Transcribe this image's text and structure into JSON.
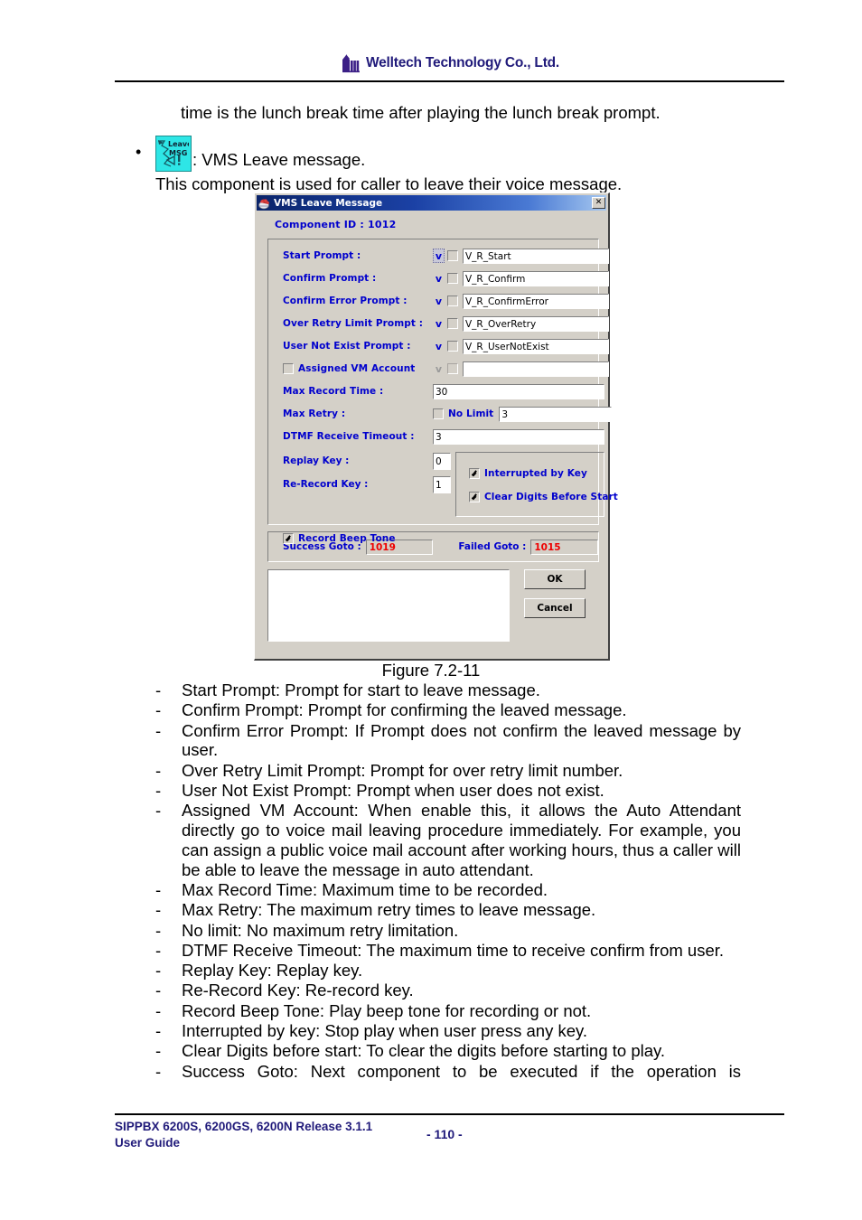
{
  "header": {
    "company": "Welltech Technology Co., Ltd.",
    "logo_icon": "welltech-logo-icon"
  },
  "intro_line": "time is the lunch break time after playing the lunch break prompt.",
  "bullet": {
    "marker": "•",
    "icon_name": "leave-msg-icon",
    "icon_text_top": "Leave",
    "icon_text_bottom": "MSG",
    "caption": ": VMS Leave message.",
    "description": "This component is used for caller to leave their voice message."
  },
  "dialog": {
    "title": "VMS Leave Message",
    "title_icon": "vms-app-icon",
    "close_label": "✕",
    "component_id": "Component ID : 1012",
    "prompt_rows": [
      {
        "label": "Start Prompt :",
        "dropdown": "v",
        "dropdown_focused": true,
        "checked": false,
        "value": "V_R_Start"
      },
      {
        "label": "Confirm Prompt :",
        "dropdown": "v",
        "dropdown_focused": false,
        "checked": false,
        "value": "V_R_Confirm"
      },
      {
        "label": "Confirm Error Prompt :",
        "dropdown": "v",
        "dropdown_focused": false,
        "checked": false,
        "value": "V_R_ConfirmError"
      },
      {
        "label": "Over Retry Limit Prompt :",
        "dropdown": "v",
        "dropdown_focused": false,
        "checked": false,
        "value": "V_R_OverRetry"
      },
      {
        "label": "User Not Exist Prompt :",
        "dropdown": "v",
        "dropdown_focused": false,
        "checked": false,
        "value": "V_R_UserNotExist"
      }
    ],
    "assigned_vm": {
      "label": "Assigned VM Account",
      "checked": false,
      "dropdown": "v",
      "value": ""
    },
    "max_record_time": {
      "label": "Max Record Time :",
      "value": "30"
    },
    "max_retry": {
      "label": "Max Retry :",
      "no_limit_label": "No Limit",
      "no_limit_checked": false,
      "value": "3"
    },
    "dtmf_timeout": {
      "label": "DTMF Receive Timeout :",
      "value": "3"
    },
    "replay_key": {
      "label": "Replay Key :",
      "value": "0"
    },
    "rerecord_key": {
      "label": "Re-Record Key :",
      "value": "1"
    },
    "record_beep_tone": {
      "label": "Record Beep Tone",
      "checked": true
    },
    "options": [
      {
        "label": "Interrupted by Key",
        "checked": true
      },
      {
        "label": "Clear Digits Before Start",
        "checked": true
      }
    ],
    "success_goto": {
      "label": "Success Goto :",
      "value": "1019"
    },
    "failed_goto": {
      "label": "Failed Goto :",
      "value": "1015"
    },
    "note_box_value": "",
    "ok_label": "OK",
    "cancel_label": "Cancel",
    "colors": {
      "face": "#d4d0c8",
      "label_blue": "#0000cd",
      "goto_red": "#ee0000",
      "title_blue": "#0a246a"
    }
  },
  "figure_caption": "Figure 7.2-11",
  "dash_list": [
    {
      "mark": "-",
      "text": "Start Prompt: Prompt for start to leave message.",
      "justify": false
    },
    {
      "mark": "-",
      "text": "Confirm Prompt: Prompt for confirming the leaved message.",
      "justify": false
    },
    {
      "mark": "-",
      "text": "Confirm Error Prompt: If Prompt does not confirm the leaved message by user.",
      "justify": true
    },
    {
      "mark": "-",
      "text": "Over Retry Limit Prompt: Prompt for over retry limit number.",
      "justify": false
    },
    {
      "mark": "-",
      "text": "User Not Exist Prompt: Prompt when user does not exist.",
      "justify": false
    },
    {
      "mark": "-",
      "text": "Assigned VM Account: When enable this, it allows the Auto Attendant directly go to voice mail leaving procedure immediately. For example, you can assign a public voice mail account after working hours, thus a caller will be able to leave the message in auto attendant.",
      "justify": true
    },
    {
      "mark": "-",
      "text": "Max Record Time: Maximum time to be recorded.",
      "justify": false
    },
    {
      "mark": "-",
      "text": "Max Retry: The maximum retry times to leave message.",
      "justify": false
    },
    {
      "mark": "-",
      "text": "No limit: No maximum retry limitation.",
      "justify": false
    },
    {
      "mark": "-",
      "text": "DTMF Receive Timeout: The maximum time to receive confirm from user.",
      "justify": true
    },
    {
      "mark": "-",
      "text": "Replay Key: Replay key.",
      "justify": false
    },
    {
      "mark": "-",
      "text": "Re-Record Key: Re-record key.",
      "justify": false
    },
    {
      "mark": "-",
      "text": "Record Beep Tone: Play beep tone for recording or not.",
      "justify": false
    },
    {
      "mark": "-",
      "text": "Interrupted by key: Stop play when user press any key.",
      "justify": false
    },
    {
      "mark": "-",
      "text": "Clear Digits before start: To clear the digits before starting to play.",
      "justify": false
    },
    {
      "mark": "-",
      "text": "Success Goto: Next component to be executed if the operation is",
      "justify": true
    }
  ],
  "footer": {
    "line1": "SIPPBX 6200S, 6200GS, 6200N Release 3.1.1",
    "line2": "User Guide",
    "page": "- 110 -"
  }
}
